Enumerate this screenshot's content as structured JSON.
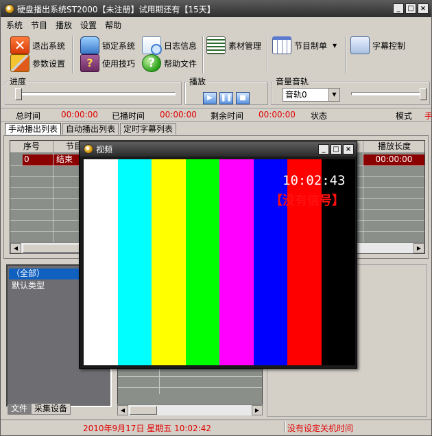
{
  "window": {
    "title": "硬盘播出系统ST2000【未注册】试用期还有【15天】",
    "min_label": "_",
    "max_label": "□",
    "close_label": "×"
  },
  "menu": [
    "系统",
    "节目",
    "播放",
    "设置",
    "帮助"
  ],
  "toolbar": {
    "exit": "退出系统",
    "params": "参数设置",
    "lock": "锁定系统",
    "tips": "使用技巧",
    "log": "日志信息",
    "help_file": "帮助文件",
    "material": "素材管理",
    "program": "节目制单",
    "subtitle": "字幕控制",
    "help_glyph": "?"
  },
  "progress": {
    "label": "进度",
    "value": 0
  },
  "playback": {
    "label": "播放",
    "play": "▶",
    "pause": "❚❚",
    "stop": "■"
  },
  "audio": {
    "label": "音量音轨",
    "track": "音轨0",
    "volume": 1.0
  },
  "times": {
    "total_label": "总时间",
    "total": "00:00:00",
    "played_label": "已播时间",
    "played": "00:00:00",
    "remaining_label": "剩余时间",
    "remaining": "00:00:00",
    "state_label": "状态",
    "mode_label": "模式",
    "mode_value": "手"
  },
  "tabs": [
    "手动播出列表",
    "自动播出列表",
    "定时字幕列表"
  ],
  "grid": {
    "col_seq": "序号",
    "col_prog": "节目",
    "col_len": "播放长度",
    "row_seq": "0",
    "row_prog": "结束",
    "row_len": "00:00:00"
  },
  "categories": [
    "（全部）",
    "默认类型"
  ],
  "bottom_tabs": [
    "文件",
    "采集设备"
  ],
  "status": {
    "datetime": "2010年9月17日  星期五  10:02:42",
    "shutdown": "没有设定关机时间"
  },
  "video": {
    "title": "视频",
    "clock": "10:02:43",
    "source": "【没有信号】",
    "bars": [
      "#ffffff",
      "#00ffff",
      "#ffff00",
      "#00ff00",
      "#ff00ff",
      "#0000ff",
      "#ff0000",
      "#000000"
    ]
  }
}
